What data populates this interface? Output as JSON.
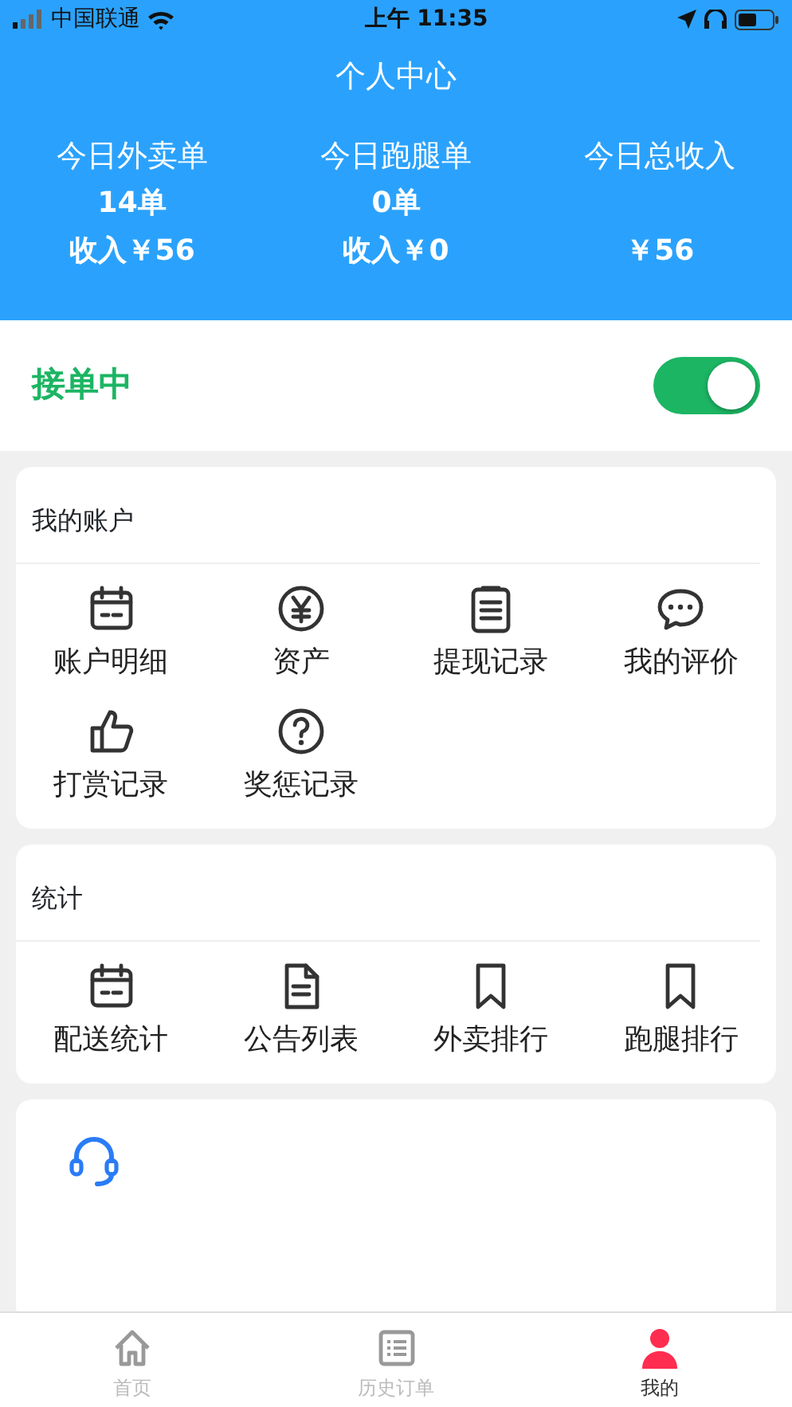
{
  "status_bar": {
    "carrier": "中国联通",
    "time": "上午 11:35"
  },
  "header": {
    "title": "个人中心",
    "stats": [
      {
        "label": "今日外卖单",
        "count": "14单",
        "income": "收入￥56"
      },
      {
        "label": "今日跑腿单",
        "count": "0单",
        "income": "收入￥0"
      },
      {
        "label": "今日总收入",
        "income": "￥56"
      }
    ]
  },
  "accepting": {
    "label": "接单中",
    "on": true
  },
  "sections": [
    {
      "kind": "grid",
      "title": "我的账户",
      "items": [
        "账户明细",
        "资产",
        "提现记录",
        "我的评价",
        "打赏记录",
        "奖惩记录"
      ]
    },
    {
      "kind": "grid",
      "title": "统计",
      "items": [
        "配送统计",
        "公告列表",
        "外卖排行",
        "跑腿排行"
      ]
    },
    {
      "kind": "contact"
    }
  ],
  "tab_bar": [
    {
      "label": "首页",
      "selected": false
    },
    {
      "label": "历史订单",
      "selected": false
    },
    {
      "label": "我的",
      "selected": true
    }
  ]
}
